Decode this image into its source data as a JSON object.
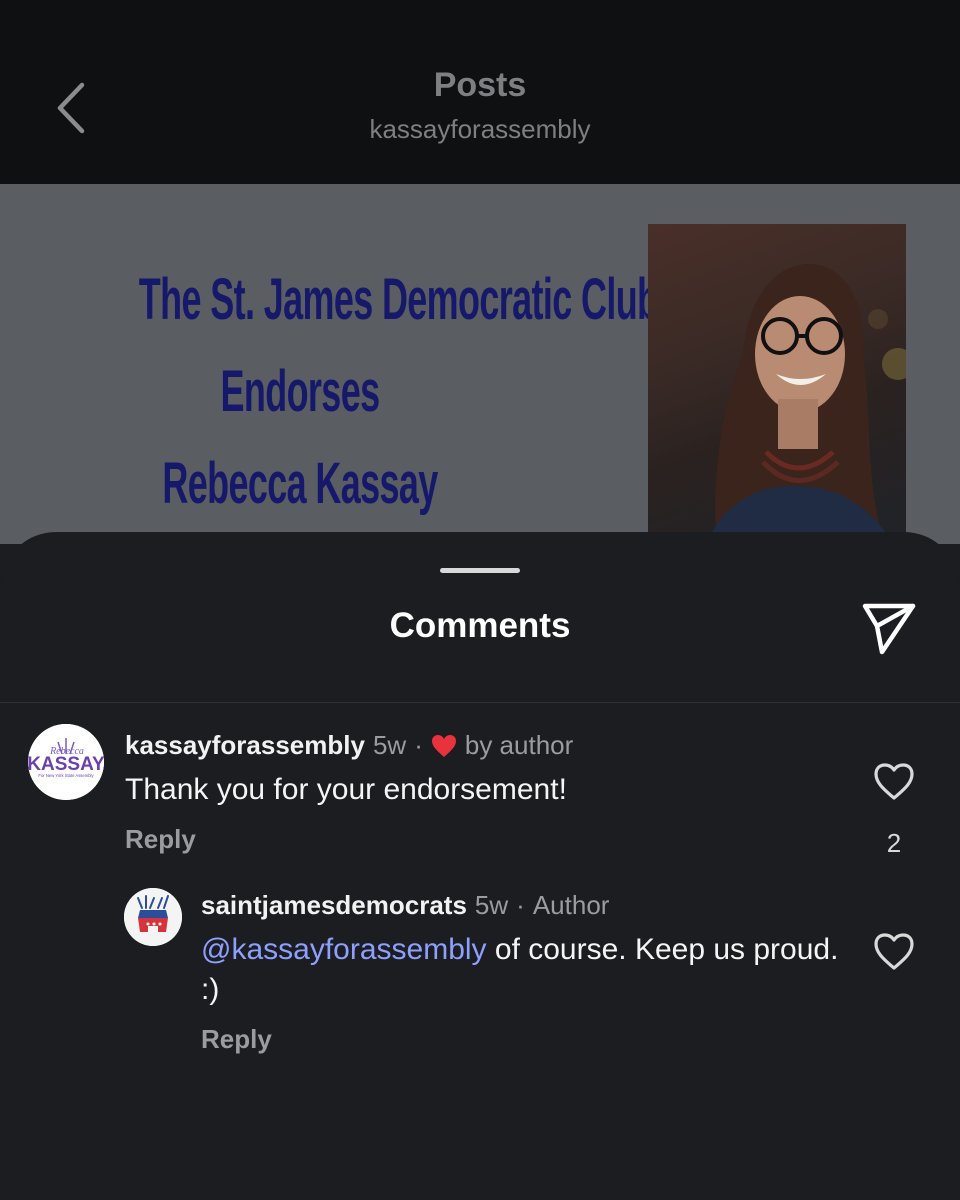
{
  "header": {
    "title": "Posts",
    "subtitle": "kassayforassembly",
    "back_icon": "chevron-left-icon"
  },
  "post": {
    "headline": [
      "The St. James Democratic Club",
      "Endorses",
      "Rebecca Kassay"
    ],
    "headline_color": "#16196a"
  },
  "comments_sheet": {
    "title": "Comments",
    "share_icon": "send-icon"
  },
  "comments": [
    {
      "avatar_logo": {
        "top": "Rebecca",
        "main": "KASSAY",
        "bottom": "For New York State Assembly"
      },
      "username": "kassayforassembly",
      "age": "5w",
      "separator": "·",
      "liked_by_author_label": "by author",
      "text": "Thank you for your endorsement!",
      "reply_label": "Reply",
      "like_count": "2"
    },
    {
      "username": "saintjamesdemocrats",
      "age": "5w",
      "separator": "·",
      "author_badge": "Author",
      "mention": "@kassayforassembly",
      "text": " of course. Keep us proud. :)",
      "reply_label": "Reply"
    }
  ],
  "colors": {
    "background": "#1b1d20",
    "heart_red": "#e8323c",
    "mention": "#8ea0ff"
  }
}
